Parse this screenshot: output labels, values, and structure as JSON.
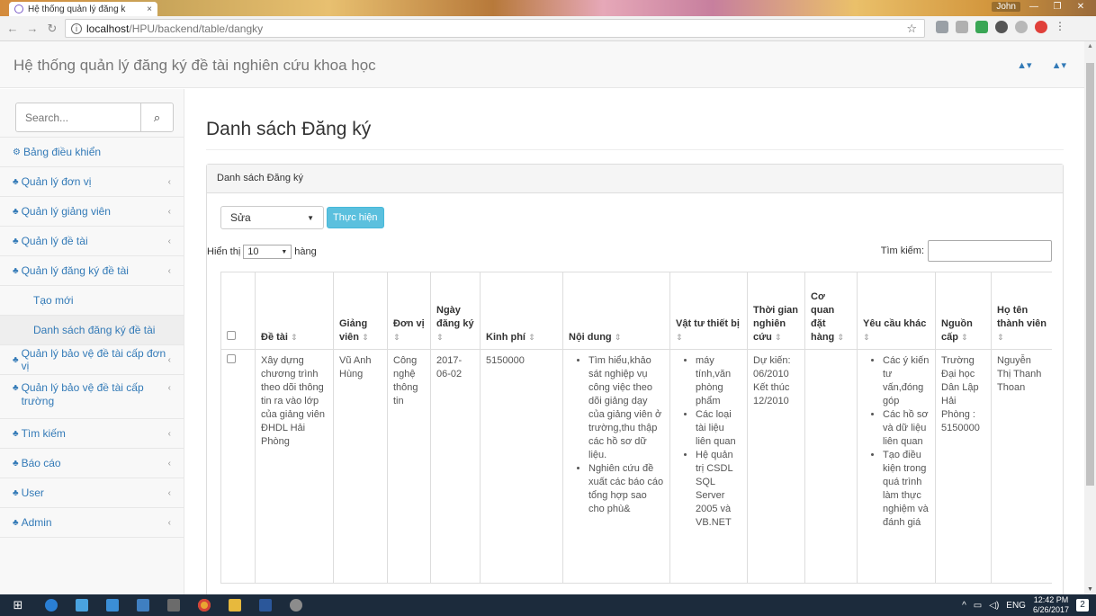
{
  "browser": {
    "tab_title": "Hệ thống quản lý đăng k",
    "tab_close": "×",
    "user_name": "John",
    "url_host": "localhost",
    "url_path": "/HPU/backend/table/dangky",
    "star": "☆"
  },
  "header": {
    "brand": "Hệ thống quản lý đăng ký đề tài nghiên cứu khoa học",
    "bell_icon": "▲▾",
    "user_icon": "▲▾"
  },
  "sidebar": {
    "search_placeholder": "Search...",
    "items": [
      {
        "label": "Bảng điều khiển",
        "icon": "⚙",
        "chevron": ""
      },
      {
        "label": "Quản lý đơn vị",
        "icon": "♣",
        "chevron": "‹"
      },
      {
        "label": "Quản lý giảng viên",
        "icon": "♣",
        "chevron": "‹"
      },
      {
        "label": "Quản lý đề tài",
        "icon": "♣",
        "chevron": "‹"
      },
      {
        "label": "Quản lý đăng ký đề tài",
        "icon": "♣",
        "chevron": "‹"
      }
    ],
    "sub_items": [
      "Tạo mới",
      "Danh sách đăng ký đề tài"
    ],
    "items2": [
      {
        "label": "Quản lý bảo vệ đề tài cấp đơn vị",
        "icon": "♣",
        "chevron": "‹"
      },
      {
        "label": "Quản lý bảo vệ đề tài cấp trường",
        "icon": "♣",
        "chevron": "‹"
      },
      {
        "label": "Tìm kiếm",
        "icon": "♣",
        "chevron": "‹"
      },
      {
        "label": "Báo cáo",
        "icon": "♣",
        "chevron": "‹"
      },
      {
        "label": "User",
        "icon": "♣",
        "chevron": "‹"
      },
      {
        "label": "Admin",
        "icon": "♣",
        "chevron": "‹"
      }
    ]
  },
  "main": {
    "page_title": "Danh sách Đăng ký",
    "panel_title": "Danh sách Đăng ký",
    "action_select": "Sửa",
    "action_button": "Thực hiện",
    "length_prefix": "Hiển thị",
    "length_value": "10",
    "length_suffix": "hàng",
    "filter_label": "Tìm kiếm:"
  },
  "table": {
    "columns": [
      "Đề tài",
      "Giảng viên",
      "Đơn vị",
      "Ngày đăng ký",
      "Kinh phí",
      "Nội dung",
      "Vật tư thiết bị",
      "Thời gian nghiên cứu",
      "Cơ quan đặt hàng",
      "Yêu cầu khác",
      "Nguồn cấp",
      "Họ tên thành viên"
    ],
    "sort_glyph": "⇕",
    "rows": [
      {
        "de_tai": "Xây dựng chương trình theo dõi thông tin ra vào lớp của giảng viên ĐHDL Hải Phòng",
        "giang_vien": "Vũ Anh Hùng",
        "don_vi": "Công nghệ thông tin",
        "ngay_dang_ky": "2017-06-02",
        "kinh_phi": "5150000",
        "noi_dung": [
          "Tìm hiểu,khảo sát nghiệp vụ công việc theo dõi giảng dạy của giảng viên ở trường,thu thập các hồ sơ dữ liệu.",
          "Nghiên cứu đề xuất các báo cáo tổng hợp sao cho phù&"
        ],
        "vat_tu": [
          "máy tính,văn phòng phẩm",
          "Các loại tài liệu liên quan",
          "Hệ quản trị CSDL SQL Server 2005 và VB.NET"
        ],
        "thoi_gian": "Dự kiến: 06/2010 Kết thúc 12/2010",
        "co_quan": "",
        "yeu_cau": [
          "Các ý kiến tư vấn,đóng góp",
          "Các hồ sơ và dữ liệu liên quan",
          "Tạo điều kiện trong quá trình làm thực nghiệm và đánh giá"
        ],
        "nguon_cap": "Trường Đại học Dân Lập Hải Phòng : 5150000",
        "thanh_vien": "Nguyễn Thị Thanh Thoan"
      }
    ]
  },
  "taskbar": {
    "lang": "ENG",
    "time": "12:42 PM",
    "date": "6/26/2017",
    "notif": "2"
  }
}
